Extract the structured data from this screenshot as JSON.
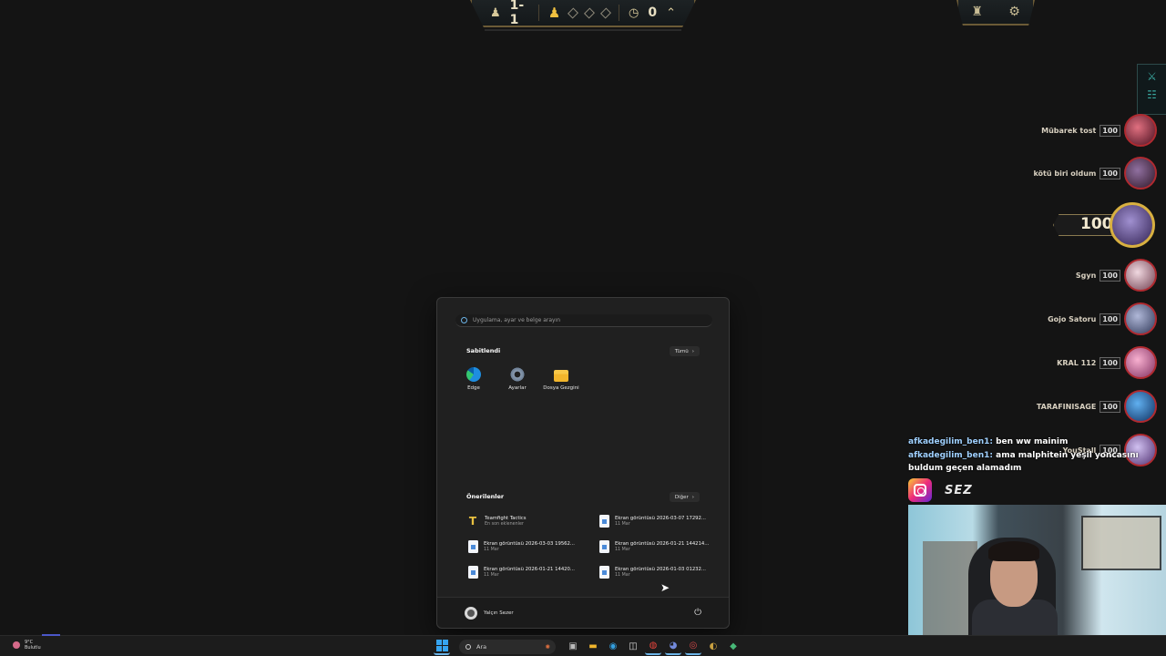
{
  "hud": {
    "stage": "1-1",
    "gold": "0",
    "icons": [
      "stage-icon",
      "player-icon",
      "diamond-icon",
      "timer-icon",
      "chevron-up-icon"
    ],
    "right_icons": [
      "team-planner-icon",
      "settings-icon"
    ]
  },
  "players": [
    {
      "name": "Mübarek tost",
      "hp": "100"
    },
    {
      "name": "kötü biri oldum",
      "hp": "100"
    },
    {
      "name": "Sgyn",
      "hp": "100"
    },
    {
      "name": "Gojo Satoru",
      "hp": "100"
    },
    {
      "name": "KRAL 112",
      "hp": "100"
    },
    {
      "name": "TARAFINISAGE",
      "hp": "100"
    },
    {
      "name": "YouStall",
      "hp": "100"
    }
  ],
  "me": {
    "hp": "100"
  },
  "chat": [
    {
      "user": "afkadegilim_ben1:",
      "text": " ben ww mainim"
    },
    {
      "user": "afkadegilim_ben1:",
      "text": " ama malphitein yeşil yoncasını buldum geçen alamadım"
    }
  ],
  "social": {
    "brand": "SEZ"
  },
  "start_menu": {
    "search_placeholder": "Uygulama, ayar ve belge arayın",
    "pinned_title": "Sabitlendi",
    "all_button": "Tümü",
    "pinned": [
      {
        "label": "Edge",
        "icon": "edge-icon"
      },
      {
        "label": "Ayarlar",
        "icon": "settings-icon"
      },
      {
        "label": "Dosya Gezgini",
        "icon": "folder-icon"
      }
    ],
    "recommended_title": "Önerilenler",
    "more_button": "Diğer",
    "recommended": [
      {
        "title": "Teamfight Tactics",
        "sub": "En son eklenenler"
      },
      {
        "title": "Ekran görüntüsü 2026-03-07 17292...",
        "sub": "11 Mar"
      },
      {
        "title": "Ekran görüntüsü 2026-03-03 19562...",
        "sub": "11 Mar"
      },
      {
        "title": "Ekran görüntüsü 2026-01-21 144214...",
        "sub": "11 Mar"
      },
      {
        "title": "Ekran görüntüsü 2026-01-21 14420...",
        "sub": "11 Mar"
      },
      {
        "title": "Ekran görüntüsü 2026-01-03 01232...",
        "sub": "11 Mar"
      }
    ],
    "user_name": "Yalçın Sezer"
  },
  "taskbar": {
    "weather_temp": "9°C",
    "weather_desc": "Bulutlu",
    "search_label": "Ara"
  }
}
